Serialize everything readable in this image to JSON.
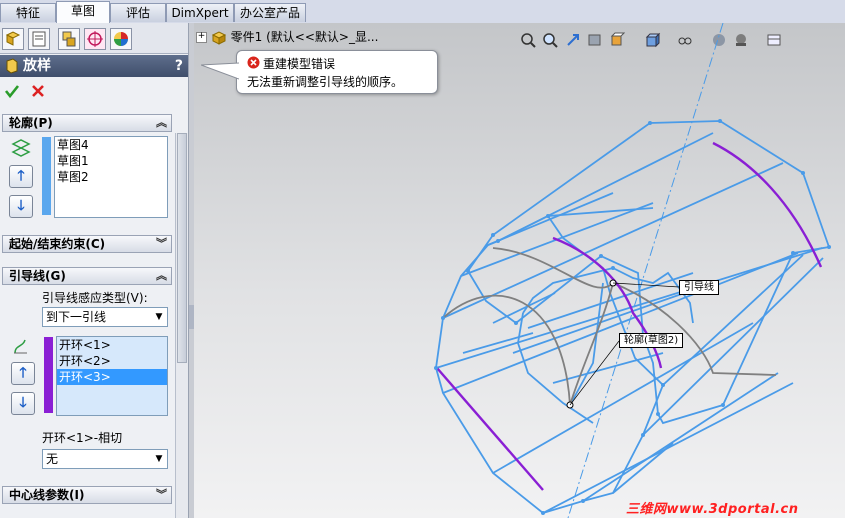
{
  "tabs": [
    {
      "label": "特征"
    },
    {
      "label": "草图"
    },
    {
      "label": "评估"
    },
    {
      "label": "DimXpert"
    },
    {
      "label": "办公室产品"
    }
  ],
  "active_tab": "草图",
  "property_manager": {
    "title": "放样",
    "help": "?",
    "ok_icon": "check-icon",
    "cancel_icon": "x-icon"
  },
  "profiles": {
    "header": "轮廓(P)",
    "items": [
      "草图4",
      "草图1",
      "草图2"
    ]
  },
  "start_end": {
    "header": "起始/结束约束(C)"
  },
  "guides": {
    "header": "引导线(G)",
    "influence_label": "引导线感应类型(V):",
    "influence_value": "到下一引线",
    "items": [
      "开环<1>",
      "开环<2>",
      "开环<3>"
    ],
    "selected_index": 2,
    "tangency_label": "开环<1>-相切",
    "tangency_value": "无"
  },
  "centerline": {
    "header": "中心线参数(I)"
  },
  "feature_tree": {
    "part": "零件1",
    "config": "(默认<<默认>_显..."
  },
  "tooltip": {
    "title": "重建模型错误",
    "message": "无法重新调整引导线的顺序。"
  },
  "callouts": {
    "guide": "引导线",
    "profile": "轮廓(草图2)"
  },
  "watermark": "三维网www.3dportal.cn",
  "colors": {
    "wire": "#4a9be8",
    "gray_curve": "#808080",
    "purple_curve": "#8a1fd4"
  }
}
